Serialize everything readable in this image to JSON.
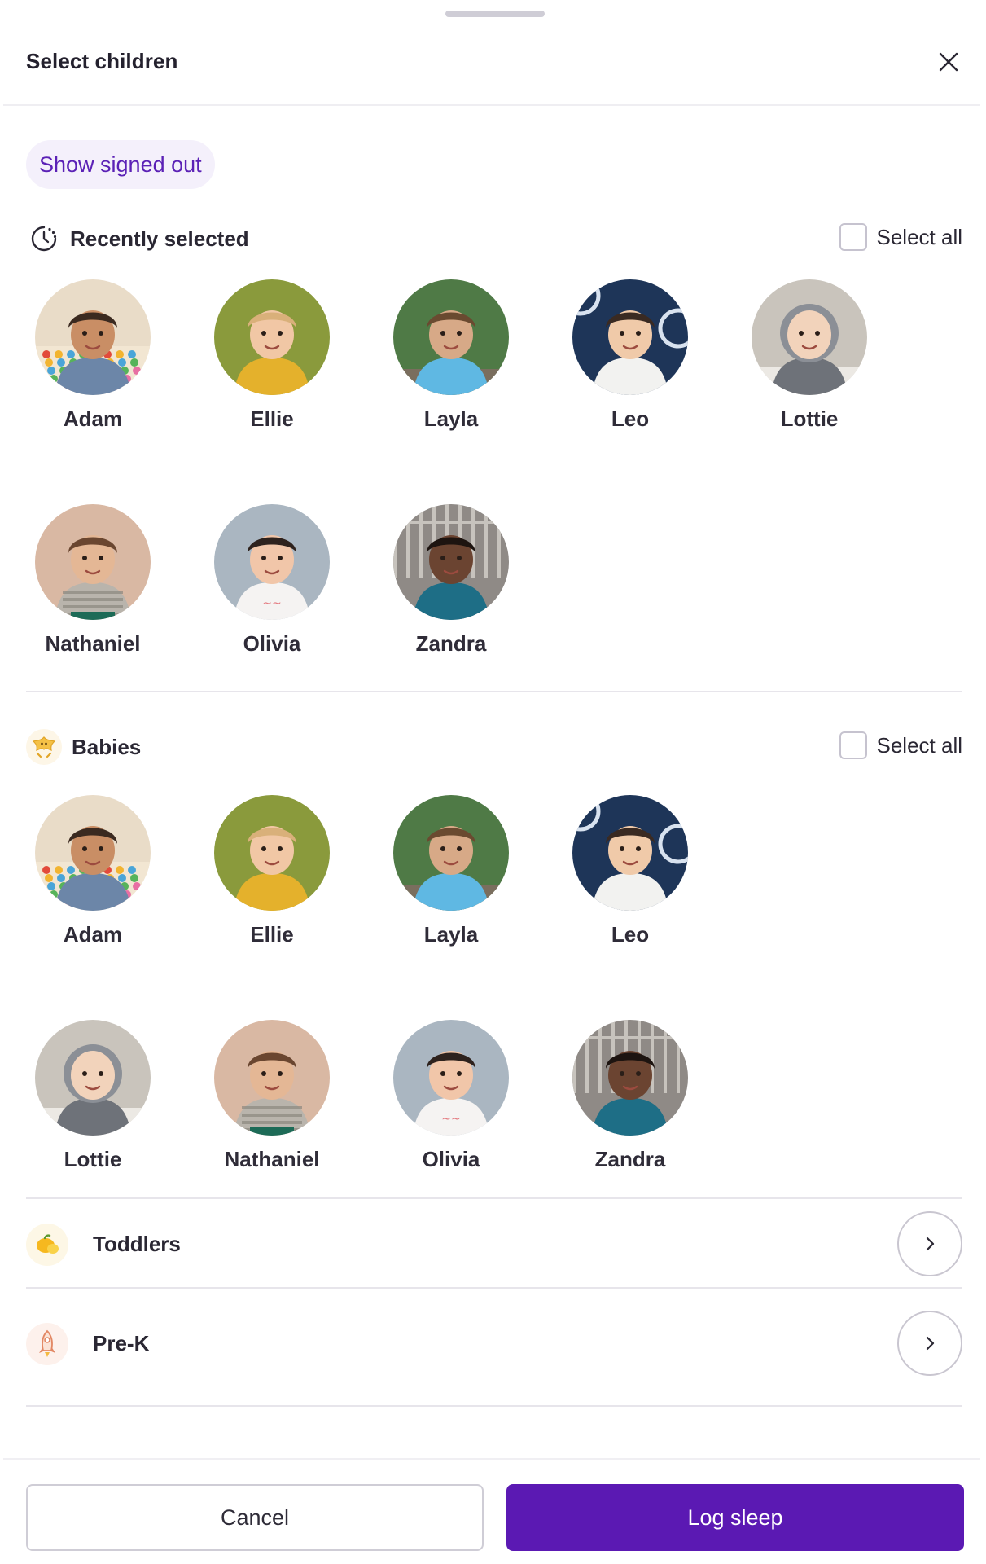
{
  "header": {
    "title": "Select children"
  },
  "filters": {
    "show_signed_out": "Show signed out"
  },
  "recent": {
    "title": "Recently selected",
    "select_all": "Select all",
    "children": [
      {
        "name": "Adam",
        "photo": "abacus"
      },
      {
        "name": "Ellie",
        "photo": "yellow"
      },
      {
        "name": "Layla",
        "photo": "garden"
      },
      {
        "name": "Leo",
        "photo": "navy"
      },
      {
        "name": "Lottie",
        "photo": "snow"
      },
      {
        "name": "Nathaniel",
        "photo": "stripes"
      },
      {
        "name": "Olivia",
        "photo": "tongue"
      },
      {
        "name": "Zandra",
        "photo": "teal"
      }
    ]
  },
  "babies": {
    "title": "Babies",
    "select_all": "Select all",
    "children": [
      {
        "name": "Adam",
        "photo": "abacus"
      },
      {
        "name": "Ellie",
        "photo": "yellow"
      },
      {
        "name": "Layla",
        "photo": "garden"
      },
      {
        "name": "Leo",
        "photo": "navy"
      },
      {
        "name": "Lottie",
        "photo": "snow"
      },
      {
        "name": "Nathaniel",
        "photo": "stripes"
      },
      {
        "name": "Olivia",
        "photo": "tongue"
      },
      {
        "name": "Zandra",
        "photo": "teal"
      }
    ]
  },
  "groups": [
    {
      "label": "Toddlers",
      "icon": "lemon-icon"
    },
    {
      "label": "Pre-K",
      "icon": "rocket-icon"
    }
  ],
  "footer": {
    "cancel": "Cancel",
    "primary": "Log sleep"
  },
  "colors": {
    "accent": "#5b19b3",
    "pill_bg": "#f4f0fb",
    "pill_text": "#5b21b6"
  }
}
